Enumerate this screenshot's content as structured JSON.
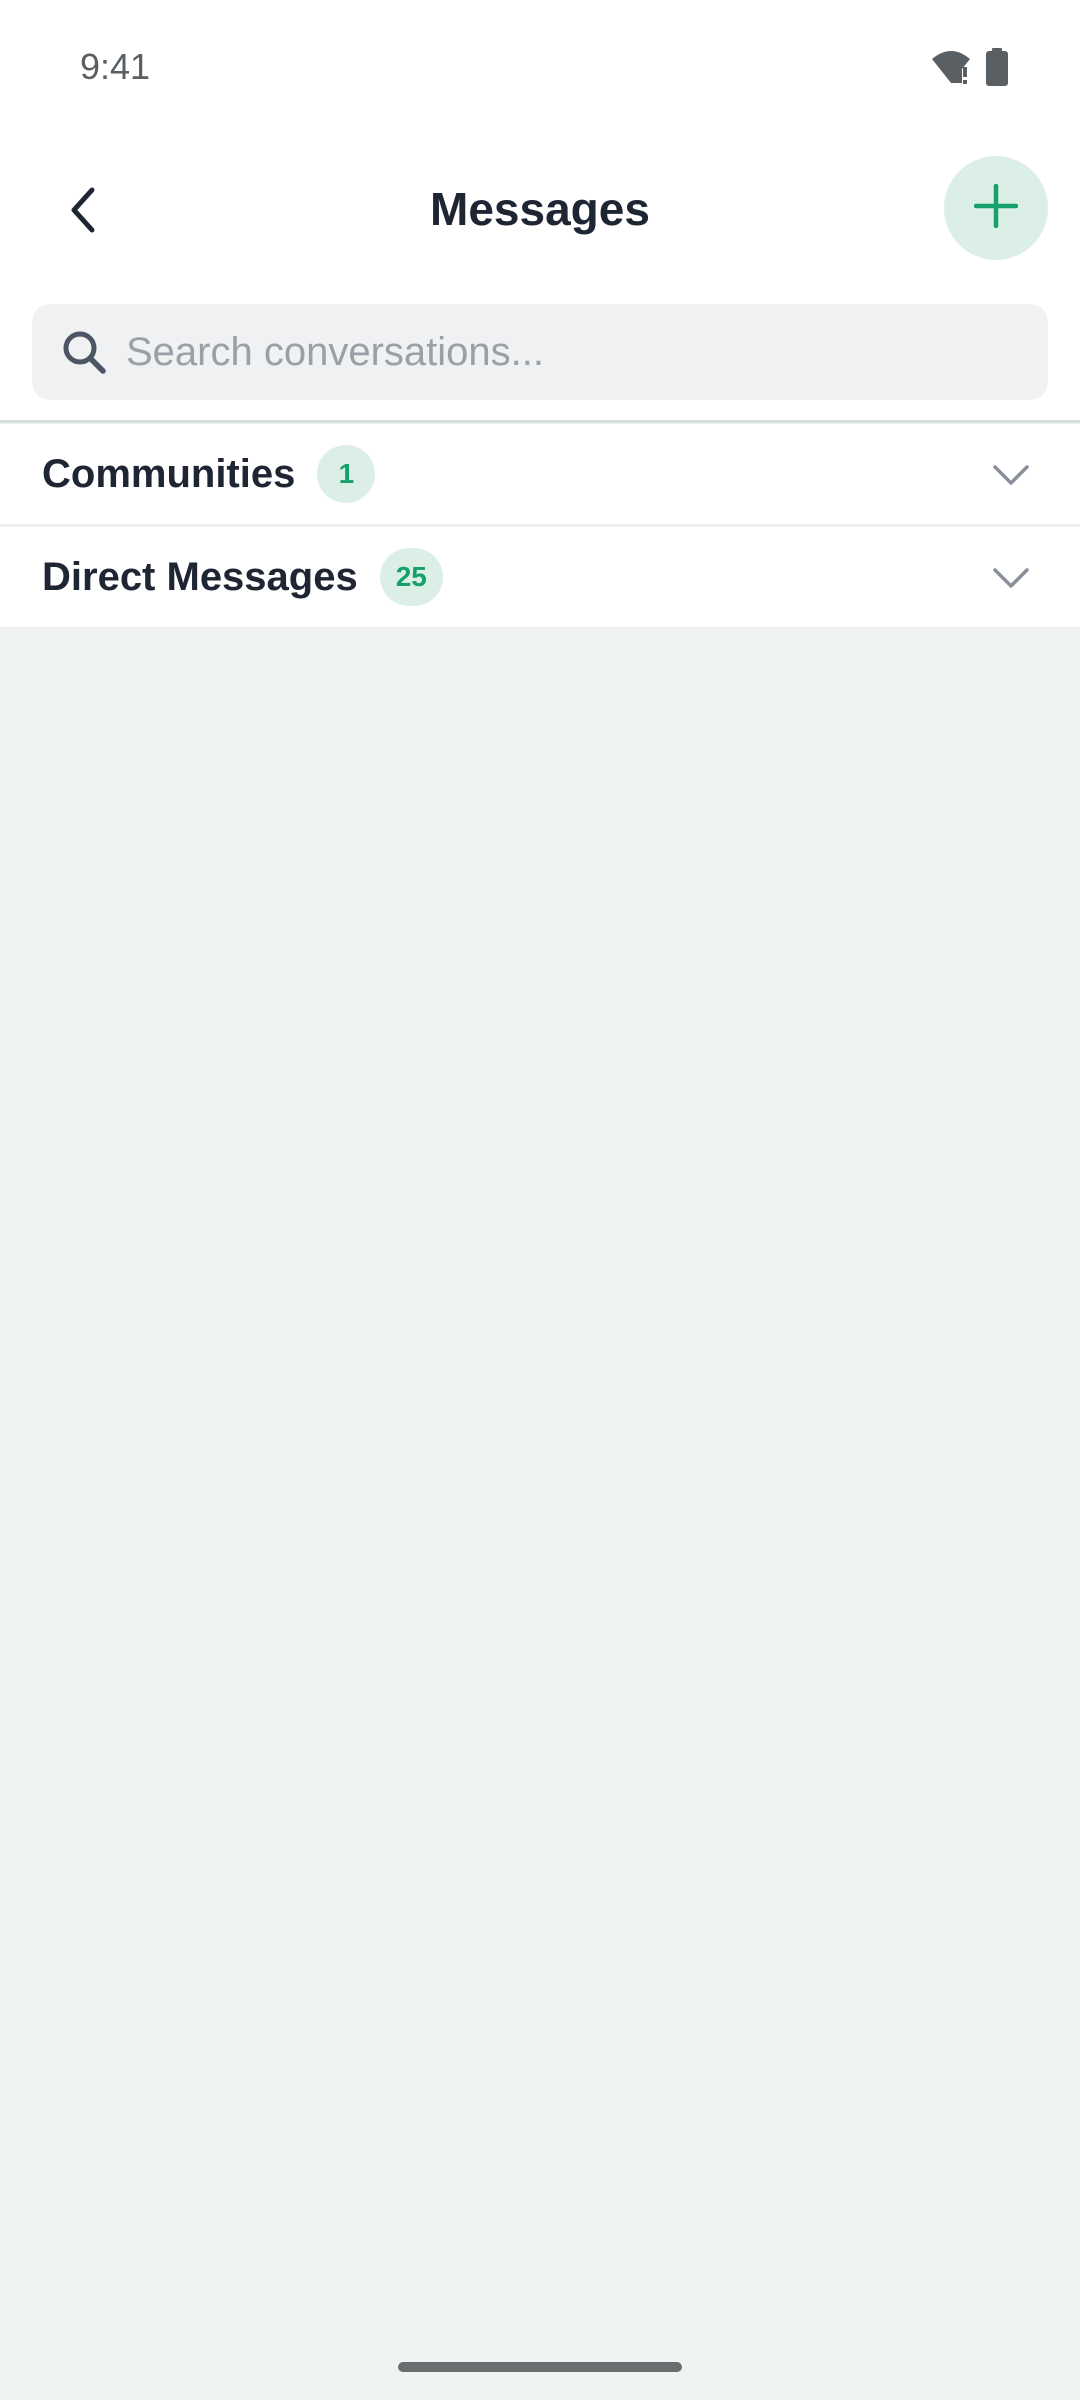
{
  "status_bar": {
    "time": "9:41",
    "icons": [
      "wifi-alert-icon",
      "battery-icon"
    ]
  },
  "header": {
    "title": "Messages",
    "back_icon": "chevron-left-icon",
    "add_icon": "plus-icon"
  },
  "search": {
    "placeholder": "Search conversations...",
    "value": "",
    "icon": "search-icon"
  },
  "sections": [
    {
      "label": "Communities",
      "count": "1",
      "icon": "chevron-down-icon"
    },
    {
      "label": "Direct Messages",
      "count": "25",
      "icon": "chevron-down-icon"
    }
  ],
  "colors": {
    "accent": "#16A06E",
    "accent_light": "#DCEFE7",
    "background": "#EFF4F2",
    "text_primary": "#1E2533",
    "placeholder": "#9AA0A8"
  }
}
